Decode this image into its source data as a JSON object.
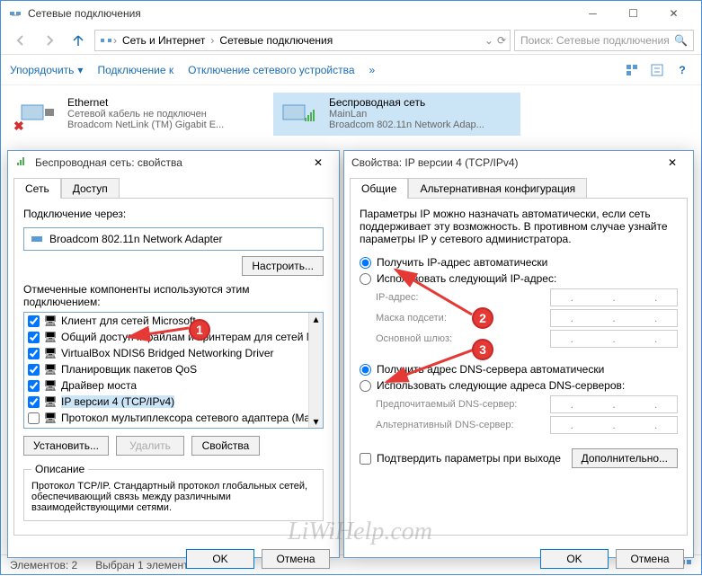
{
  "window": {
    "title": "Сетевые подключения",
    "breadcrumb": {
      "parent": "Сеть и Интернет",
      "current": "Сетевые подключения"
    },
    "search_placeholder": "Поиск: Сетевые подключения"
  },
  "toolbar": {
    "organize": "Упорядочить",
    "connect_to": "Подключение к",
    "disable": "Отключение сетевого устройства"
  },
  "adapters": {
    "ethernet": {
      "name": "Ethernet",
      "status": "Сетевой кабель не подключен",
      "device": "Broadcom NetLink (TM) Gigabit E..."
    },
    "wifi": {
      "name": "Беспроводная сеть",
      "status": "MainLan",
      "device": "Broadcom 802.11n Network Adap..."
    }
  },
  "props_dialog": {
    "title": "Беспроводная сеть: свойства",
    "tabs": {
      "net": "Сеть",
      "access": "Доступ"
    },
    "connect_via": "Подключение через:",
    "adapter": "Broadcom 802.11n Network Adapter",
    "configure": "Настроить...",
    "components_label": "Отмеченные компоненты используются этим подключением:",
    "components": [
      {
        "checked": true,
        "label": "Клиент для сетей Microsoft"
      },
      {
        "checked": true,
        "label": "Общий доступ к файлам и принтерам для сетей Mi"
      },
      {
        "checked": true,
        "label": "VirtualBox NDIS6 Bridged Networking Driver"
      },
      {
        "checked": true,
        "label": "Планировщик пакетов QoS"
      },
      {
        "checked": true,
        "label": "Драйвер моста"
      },
      {
        "checked": true,
        "label": "IP версии 4 (TCP/IPv4)",
        "highlight": true
      },
      {
        "checked": false,
        "label": "Протокол мультиплексора сетевого адаптера (Ma"
      }
    ],
    "install": "Установить...",
    "uninstall": "Удалить",
    "properties": "Свойства",
    "desc_title": "Описание",
    "desc": "Протокол TCP/IP. Стандартный протокол глобальных сетей, обеспечивающий связь между различными взаимодействующими сетями.",
    "ok": "OK",
    "cancel": "Отмена"
  },
  "ipv4_dialog": {
    "title": "Свойства: IP версии 4 (TCP/IPv4)",
    "tabs": {
      "general": "Общие",
      "alt": "Альтернативная конфигурация"
    },
    "intro": "Параметры IP можно назначать автоматически, если сеть поддерживает эту возможность. В противном случае узнайте параметры IP у сетевого администратора.",
    "ip_auto": "Получить IP-адрес автоматически",
    "ip_manual": "Использовать следующий IP-адрес:",
    "ip_addr": "IP-адрес:",
    "mask": "Маска подсети:",
    "gateway": "Основной шлюз:",
    "dns_auto": "Получить адрес DNS-сервера автоматически",
    "dns_manual": "Использовать следующие адреса DNS-серверов:",
    "dns_pref": "Предпочитаемый DNS-сервер:",
    "dns_alt": "Альтернативный DNS-сервер:",
    "validate": "Подтвердить параметры при выходе",
    "advanced": "Дополнительно...",
    "ok": "OK",
    "cancel": "Отмена"
  },
  "markers": {
    "m1": "1",
    "m2": "2",
    "m3": "3"
  },
  "status": {
    "count": "Элементов: 2",
    "selected": "Выбран 1 элемент"
  },
  "watermark": "LiWiHelp.com"
}
